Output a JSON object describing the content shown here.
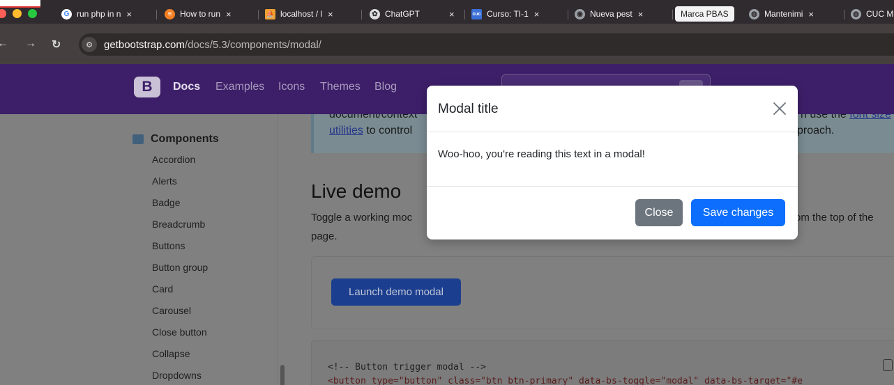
{
  "browser": {
    "tabs": [
      {
        "title": "run php in n",
        "icon": "google-icon",
        "color": "#4285f4"
      },
      {
        "title": "How to run",
        "icon": "stackoverflow-icon",
        "color": "#f48024"
      },
      {
        "title": "localhost / l",
        "icon": "phpmyadmin-icon",
        "color": "#f0a030"
      },
      {
        "title": "ChatGPT",
        "icon": "chatgpt-icon",
        "color": "#dddddd"
      },
      {
        "title": "Curso: TI-1",
        "icon": "cuc-icon",
        "color": "#3a6fd8"
      },
      {
        "title": "Nueva pest",
        "icon": "chrome-icon",
        "color": "#9aa0a6"
      },
      {
        "title": "Marca PBAS",
        "active": true
      },
      {
        "title": "Mantenimi",
        "icon": "globe-icon",
        "color": "#9aa0a6"
      },
      {
        "title": "CUC M",
        "icon": "globe-icon",
        "color": "#9aa0a6"
      }
    ],
    "tab_close": "×",
    "url_host": "getbootstrap.com",
    "url_path": "/docs/5.3/components/modal/"
  },
  "header": {
    "logo": "B",
    "nav": [
      "Docs",
      "Examples",
      "Icons",
      "Themes",
      "Blog"
    ]
  },
  "sidebar": {
    "section": "Components",
    "items": [
      "Accordion",
      "Alerts",
      "Badge",
      "Breadcrumb",
      "Buttons",
      "Button group",
      "Card",
      "Carousel",
      "Close button",
      "Collapse",
      "Dropdowns"
    ]
  },
  "content": {
    "alert_line1_left": "document/context",
    "alert_line1_right_a": "n use the ",
    "alert_line1_right_link": "font size",
    "alert_line2_link": "utilities",
    "alert_line2_left": " to control",
    "alert_line2_right": "proach.",
    "heading": "Live demo",
    "toggle_text": "Toggle a working moc",
    "toggle_text_right": "om the top of the",
    "page_text": "page.",
    "launch_button": "Launch demo modal",
    "code_line1": "<!-- Button trigger modal -->",
    "code_line2": "<button type=\"button\" class=\"btn btn-primary\" data-bs-toggle=\"modal\" data-bs-target=\"#e"
  },
  "modal": {
    "title": "Modal title",
    "body": "Woo-hoo, you're reading this text in a modal!",
    "close_button": "Close",
    "save_button": "Save changes"
  }
}
